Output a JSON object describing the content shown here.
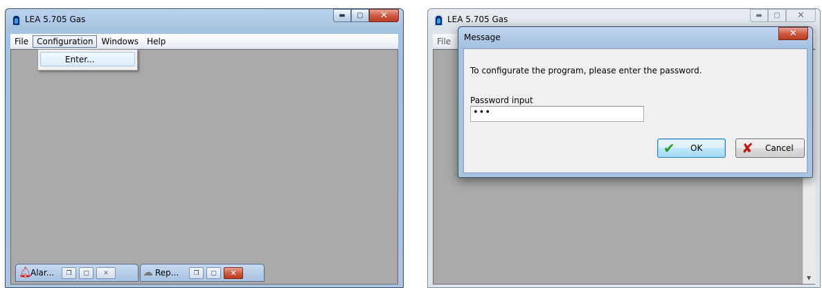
{
  "left_window": {
    "title": "LEA 5.705 Gas",
    "menu": [
      "File",
      "Configuration",
      "Windows",
      "Help"
    ],
    "dropdown_item": "Enter...",
    "minimized": [
      {
        "label": "Alar...",
        "icon": "bell-icon"
      },
      {
        "label": "Rep...",
        "icon": "report-icon"
      }
    ]
  },
  "right_window": {
    "title": "LEA 5.705 Gas",
    "menu_first": "File"
  },
  "dialog": {
    "title": "Message",
    "message": "To configurate the program, please enter the password.",
    "password_label": "Password input",
    "password_value": "•••",
    "ok_label": "OK",
    "cancel_label": "Cancel"
  },
  "colors": {
    "titlebar": "#a6c1e1",
    "client": "#a9a9a9",
    "close_button": "#cf5b43"
  }
}
